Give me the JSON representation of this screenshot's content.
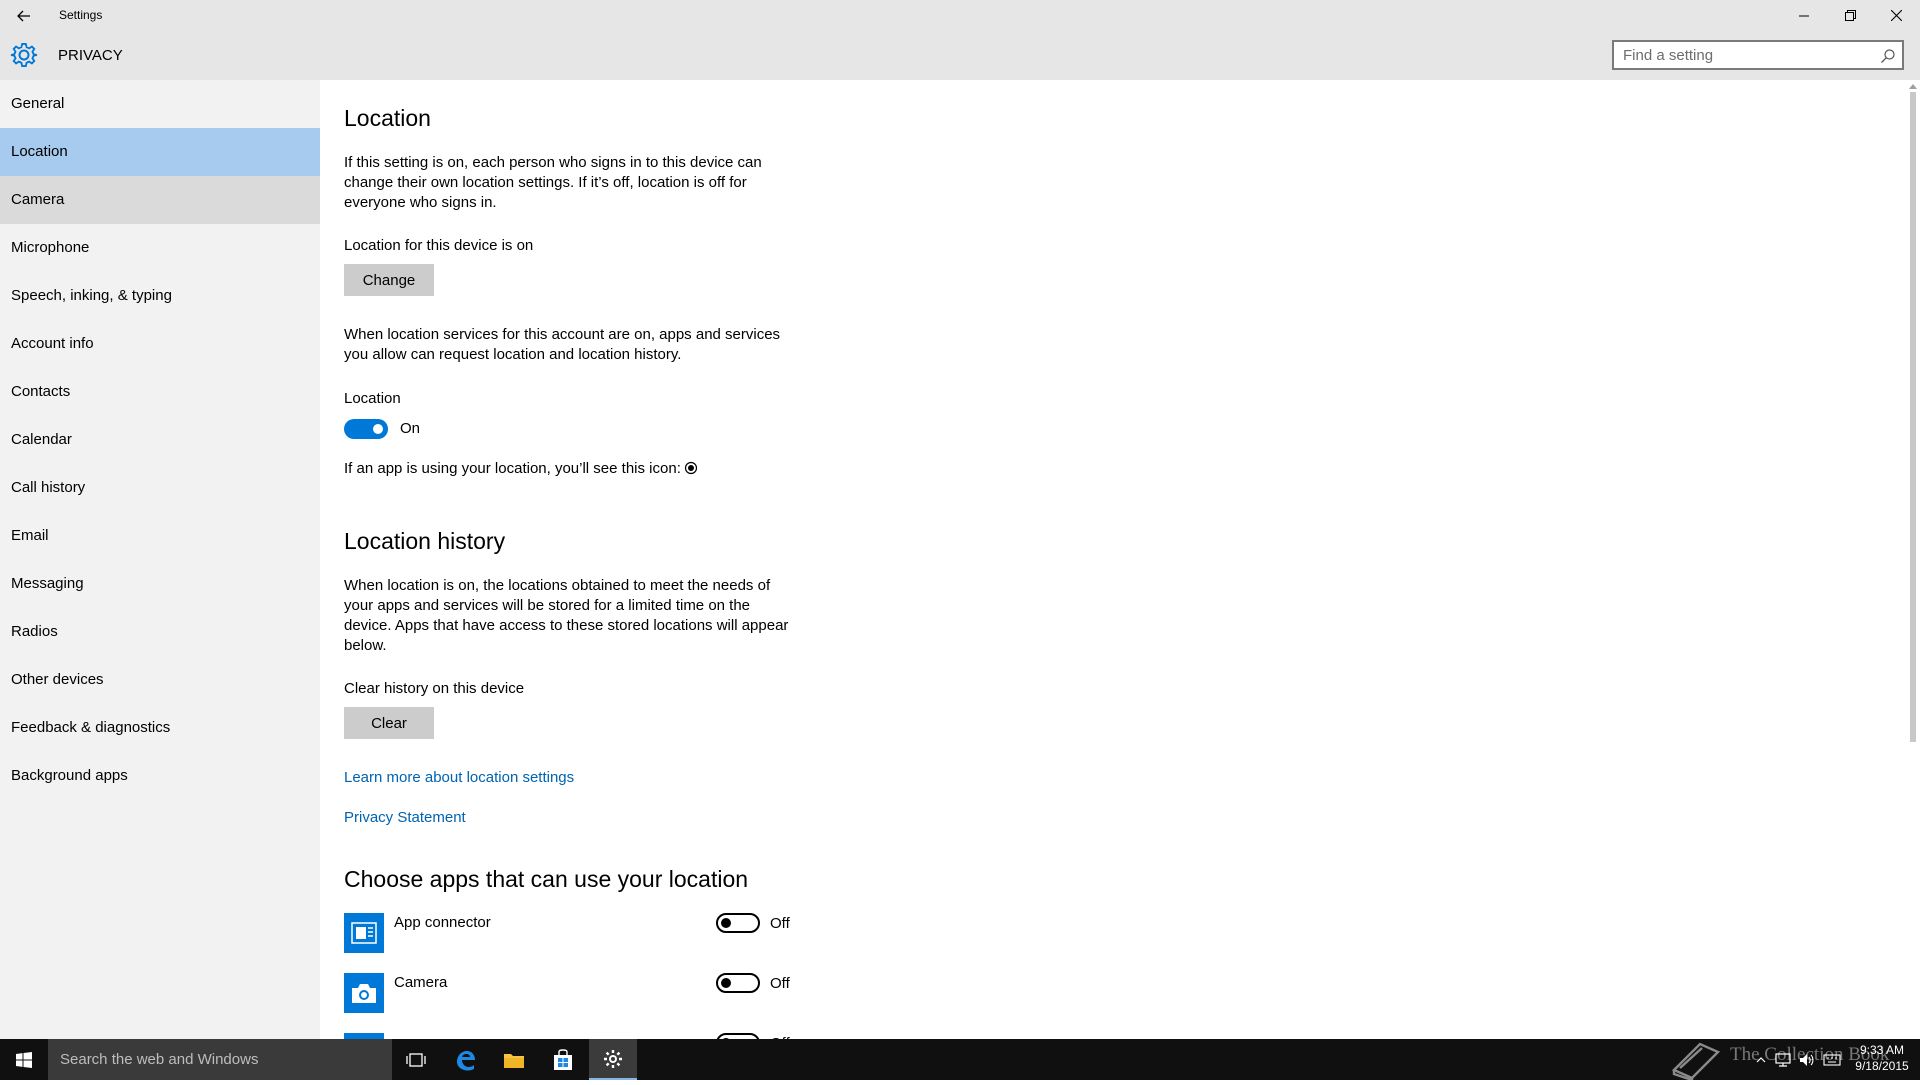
{
  "window": {
    "title": "Settings"
  },
  "header": {
    "app_title": "PRIVACY",
    "search_placeholder": "Find a setting"
  },
  "sidebar": {
    "items": [
      {
        "label": "General",
        "state": "normal"
      },
      {
        "label": "Location",
        "state": "selected"
      },
      {
        "label": "Camera",
        "state": "hover"
      },
      {
        "label": "Microphone",
        "state": "normal"
      },
      {
        "label": "Speech, inking, & typing",
        "state": "normal"
      },
      {
        "label": "Account info",
        "state": "normal"
      },
      {
        "label": "Contacts",
        "state": "normal"
      },
      {
        "label": "Calendar",
        "state": "normal"
      },
      {
        "label": "Call history",
        "state": "normal"
      },
      {
        "label": "Email",
        "state": "normal"
      },
      {
        "label": "Messaging",
        "state": "normal"
      },
      {
        "label": "Radios",
        "state": "normal"
      },
      {
        "label": "Other devices",
        "state": "normal"
      },
      {
        "label": "Feedback & diagnostics",
        "state": "normal"
      },
      {
        "label": "Background apps",
        "state": "normal"
      }
    ]
  },
  "main": {
    "location": {
      "heading": "Location",
      "description": "If this setting is on, each person who signs in to this device can change their own location settings. If it’s off, location is off for everyone who signs in.",
      "device_status": "Location for this device is on",
      "change_button": "Change",
      "account_description": "When location services for this account are on, apps and services you allow can request location and location history.",
      "toggle_label": "Location",
      "toggle_state": "On",
      "icon_note": "If an app is using your location, you’ll see this icon:"
    },
    "history": {
      "heading": "Location history",
      "description": "When location is on, the locations obtained to meet the needs of your apps and services will be stored for a limited time on the device. Apps that have access to these stored locations will appear below.",
      "clear_label": "Clear history on this device",
      "clear_button": "Clear"
    },
    "links": {
      "learn_more": "Learn more about location settings",
      "privacy": "Privacy Statement"
    },
    "apps": {
      "heading": "Choose apps that can use your location",
      "list": [
        {
          "name": "App connector",
          "state": "Off",
          "icon": "app-connector-icon"
        },
        {
          "name": "Camera",
          "state": "Off",
          "icon": "camera-icon"
        },
        {
          "name": "",
          "state": "Off",
          "icon": "app-icon"
        }
      ]
    }
  },
  "taskbar": {
    "search_text": "Search the web and Windows",
    "time": "9:33 AM",
    "date": "9/18/2015",
    "watermark": "The Collection Book"
  },
  "colors": {
    "accent": "#0078d7",
    "selected_nav": "#a6cbef",
    "link": "#0063b1"
  }
}
